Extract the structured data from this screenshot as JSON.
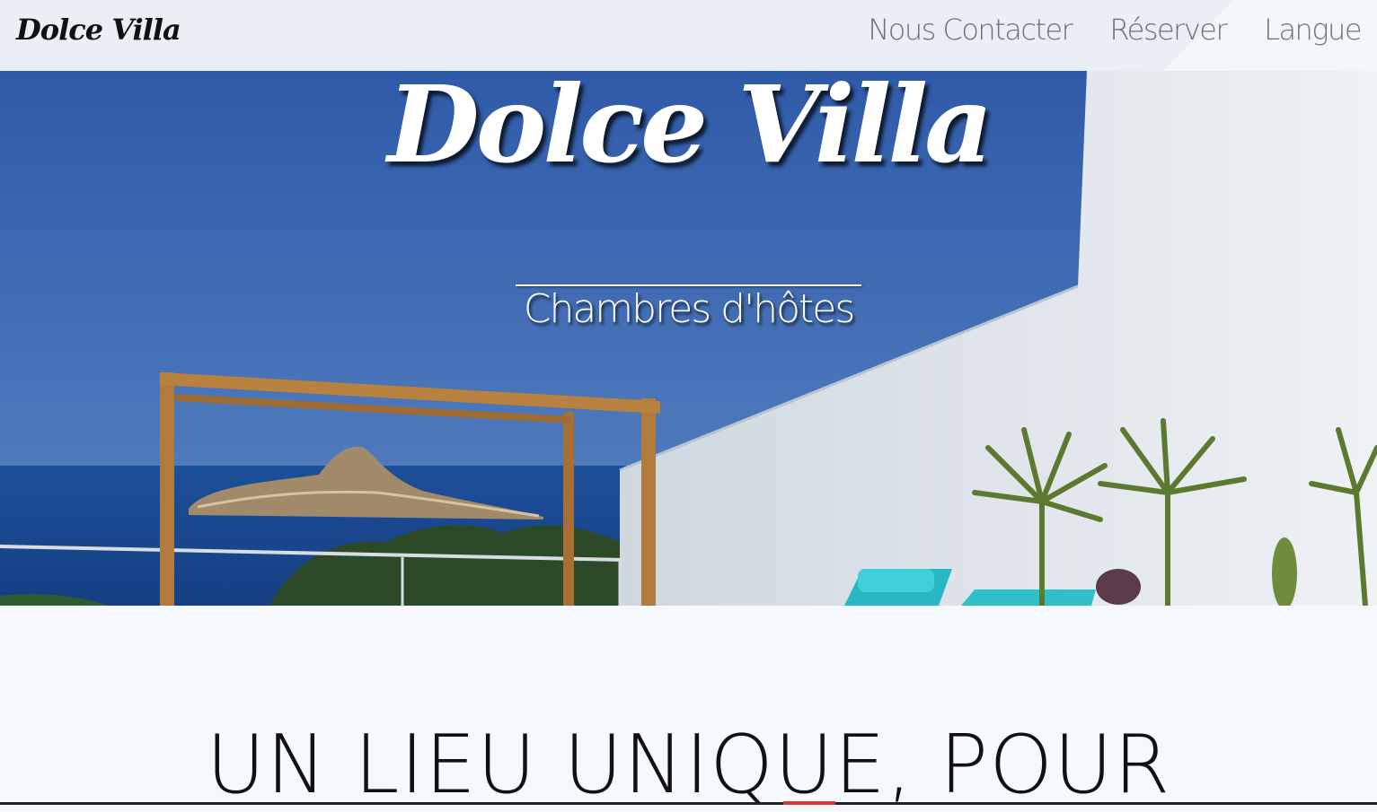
{
  "navbar": {
    "brand": "Dolce Villa",
    "links": [
      {
        "label": "Nous Contacter"
      },
      {
        "label": "Réserver"
      },
      {
        "label": "Langue"
      }
    ]
  },
  "hero": {
    "title": "Dolce Villa",
    "subtitle": "Chambres d'hôtes"
  },
  "section": {
    "heading": "UN LIEU UNIQUE, POUR"
  },
  "colors": {
    "navbar_bg": "#e9eff4",
    "sky": "#3e6db4",
    "sea": "#1f4f96",
    "wall": "#dfe6ec",
    "lounger": "#27b8c4",
    "page_bg": "#f5f9fd"
  }
}
